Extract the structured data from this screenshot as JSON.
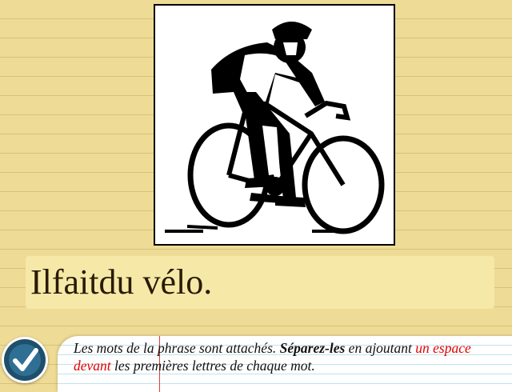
{
  "illustration": {
    "icon": "cyclist-icon"
  },
  "exercise": {
    "sentence": "Ilfaitdu vélo."
  },
  "check_button": {
    "icon": "checkmark-icon"
  },
  "instruction": {
    "part1": "Les mots de la phrase sont attachés. ",
    "bold": "Séparez-les",
    "part2": " en ajoutant ",
    "red": "un espace devant",
    "part3": " les premières lettres de chaque mot."
  },
  "colors": {
    "background": "#eedb95",
    "sentence_box": "#f6e9a8",
    "check_button": "#1f4f6b",
    "highlight": "#e00000"
  }
}
